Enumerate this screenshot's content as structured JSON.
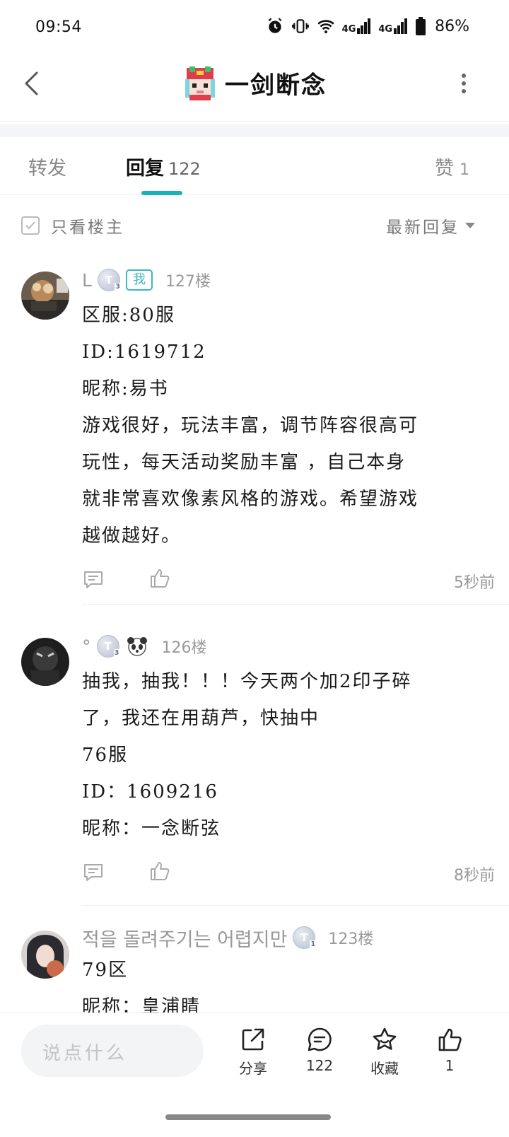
{
  "status_bar": {
    "time": "09:54",
    "signal_1": "4G",
    "signal_2": "4G",
    "battery": "86%",
    "icons": [
      "alarm-icon",
      "vibrate-icon",
      "wifi-icon",
      "signal-icon",
      "signal-icon",
      "battery-icon"
    ]
  },
  "header": {
    "title": "一剑断念",
    "back_icon": "chevron-left-icon",
    "more_icon": "more-vertical-icon"
  },
  "tabs": [
    {
      "label": "转发",
      "count": "",
      "active": false
    },
    {
      "label": "回复",
      "count": "122",
      "active": true
    },
    {
      "label": "赞",
      "count": "1",
      "active": false
    }
  ],
  "filter": {
    "only_op_label": "只看楼主",
    "only_op_checked": false,
    "sort_label": "最新回复"
  },
  "comments": [
    {
      "username": "L",
      "badge_t_level": "3",
      "me_badge": "我",
      "floor": "127楼",
      "lines": [
        "区服:80服",
        "ID:1619712",
        "昵称:易书",
        "游戏很好，玩法丰富，调节阵容很高可",
        "玩性，每天活动奖励丰富 ，自己本身",
        "就非常喜欢像素风格的游戏。希望游戏",
        "越做越好。"
      ],
      "time": "5秒前"
    },
    {
      "username": "°",
      "badge_t_level": "3",
      "floor": "126楼",
      "lines": [
        "抽我，抽我！！！今天两个加2印子碎",
        "了，我还在用葫芦，快抽中",
        "76服",
        "ID：1609216",
        "昵称：一念断弦"
      ],
      "time": "8秒前"
    },
    {
      "username": "적을 돌려주기는 어렵지만",
      "badge_t_level": "1",
      "floor": "123楼",
      "lines": [
        "79区",
        "昵称：皇浦睛"
      ]
    }
  ],
  "bottom_bar": {
    "input_placeholder": "说点什么",
    "share_label": "分享",
    "comment_count": "122",
    "favorite_label": "收藏",
    "like_count": "1"
  },
  "colors": {
    "accent": "#17b3bd",
    "me_badge": "#3cb6b9"
  }
}
